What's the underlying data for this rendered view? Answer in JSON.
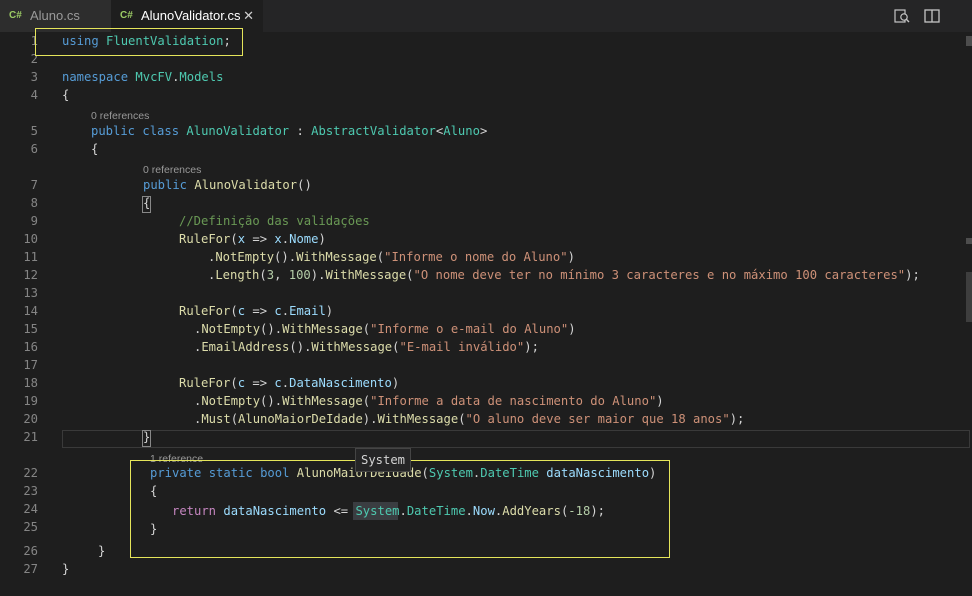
{
  "tabs": [
    {
      "icon": "C#",
      "label": "Aluno.cs",
      "active": false
    },
    {
      "icon": "C#",
      "label": "AlunoValidator.cs",
      "active": true
    }
  ],
  "toolbar": {
    "compare_icon": "open-changes-icon",
    "split_icon": "split-editor-icon"
  },
  "line_numbers": [
    "1",
    "2",
    "3",
    "4",
    "5",
    "6",
    "7",
    "8",
    "9",
    "10",
    "11",
    "12",
    "13",
    "14",
    "15",
    "16",
    "17",
    "18",
    "19",
    "20",
    "21",
    "22",
    "23",
    "24",
    "25",
    "26",
    "27"
  ],
  "code_lens": {
    "class_refs": "0 references",
    "ctor_refs": "0 references",
    "method_refs": "1 reference"
  },
  "code": {
    "l1": {
      "kw": "using",
      "ns": "FluentValidation",
      "end": ";"
    },
    "l3": {
      "kw": "namespace",
      "a": "MvcFV",
      "dot": ".",
      "b": "Models"
    },
    "l4": "{",
    "l5": {
      "kw1": "public",
      "kw2": "class",
      "name": "AlunoValidator",
      "sep": " : ",
      "base": "AbstractValidator",
      "lt": "<",
      "arg": "Aluno",
      "gt": ">"
    },
    "l6": "{",
    "l7": {
      "kw": "public",
      "name": "AlunoValidator",
      "end": "()"
    },
    "l8": "{",
    "l9": "//Definição das validações",
    "l10": {
      "fn": "RuleFor",
      "open": "(",
      "p": "x",
      "arrow": " => ",
      "obj": "x",
      "dot": ".",
      "prop": "Nome",
      "close": ")"
    },
    "l11": {
      "dot1": ".",
      "m1": "NotEmpty",
      "mid": "().",
      "m2": "WithMessage",
      "open": "(",
      "str": "\"Informe o nome do Aluno\"",
      "close": ")"
    },
    "l12": {
      "dot1": ".",
      "m1": "Length",
      "open1": "(",
      "n1": "3",
      "comma": ", ",
      "n2": "100",
      "mid": ").",
      "m2": "WithMessage",
      "open": "(",
      "str": "\"O nome deve ter no mínimo 3 caracteres e no máximo 100 caracteres\"",
      "close": ");"
    },
    "l14": {
      "fn": "RuleFor",
      "open": "(",
      "p": "c",
      "arrow": " => ",
      "obj": "c",
      "dot": ".",
      "prop": "Email",
      "close": ")"
    },
    "l15": {
      "dot1": ".",
      "m1": "NotEmpty",
      "mid": "().",
      "m2": "WithMessage",
      "open": "(",
      "str": "\"Informe o e-mail do Aluno\"",
      "close": ")"
    },
    "l16": {
      "dot1": ".",
      "m1": "EmailAddress",
      "mid": "().",
      "m2": "WithMessage",
      "open": "(",
      "str": "\"E-mail inválido\"",
      "close": ");"
    },
    "l18": {
      "fn": "RuleFor",
      "open": "(",
      "p": "c",
      "arrow": " => ",
      "obj": "c",
      "dot": ".",
      "prop": "DataNascimento",
      "close": ")"
    },
    "l19": {
      "dot1": ".",
      "m1": "NotEmpty",
      "mid": "().",
      "m2": "WithMessage",
      "open": "(",
      "str": "\"Informe a data de nascimento do Aluno\"",
      "close": ")"
    },
    "l20": {
      "dot1": ".",
      "m1": "Must",
      "open1": "(",
      "arg": "AlunoMaiorDeIdade",
      "mid": ").",
      "m2": "WithMessage",
      "open": "(",
      "str": "\"O aluno deve ser maior que 18 anos\"",
      "close": ");"
    },
    "l21": "}",
    "l22": {
      "kw1": "private",
      "kw2": "static",
      "kw3": "bool",
      "name": "AlunoMaiorDeIdade",
      "open": "(",
      "ns": "System",
      "dot": ".",
      "type": "DateTime",
      "param": " dataNascimento",
      "close": ")"
    },
    "l23": "{",
    "l24": {
      "kw": "return",
      "var": "dataNascimento",
      "op": " <= ",
      "ns": "System",
      "dot1": ".",
      "type": "DateTime",
      "dot2": ".",
      "prop": "Now",
      "dot3": ".",
      "m": "AddYears",
      "open": "(",
      "num": "-18",
      "close": ");"
    },
    "l25": "}",
    "l26": "}",
    "l27": "}"
  },
  "tooltip": "System",
  "colors": {
    "highlight_box": "#e5e55a",
    "background": "#1e1e1e",
    "keyword": "#569cd6",
    "type": "#4ec9b0",
    "string": "#ce9178",
    "comment": "#6a9955"
  }
}
